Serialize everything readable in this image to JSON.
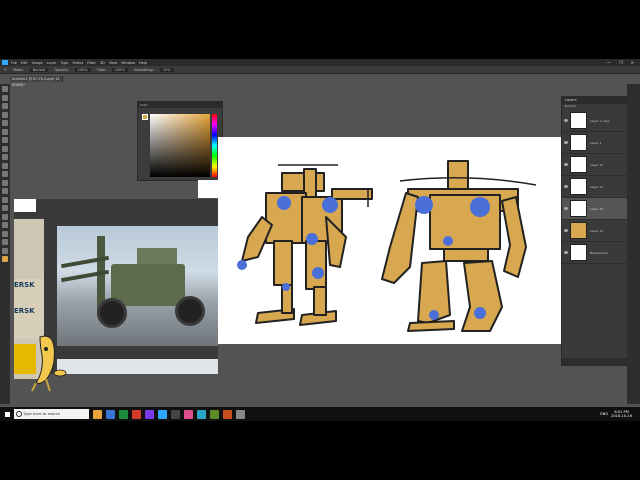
{
  "app": {
    "menu": [
      "File",
      "Edit",
      "Image",
      "Layer",
      "Type",
      "Select",
      "Filter",
      "3D",
      "View",
      "Window",
      "Help"
    ],
    "options": [
      "Mode:",
      "Normal",
      "Opacity:",
      "100%",
      "Flow:",
      "100%",
      "Smoothing:",
      "10%"
    ],
    "doc_tab": "Untitled-1 @ 67.2% (Layer 10, RGB/8)*",
    "window_controls": [
      "—",
      "❐",
      "✕"
    ]
  },
  "color_picker": {
    "title": "Color",
    "fg_color": "#d9a64e"
  },
  "layers": {
    "title": "Layers",
    "blend_mode": "Normal",
    "items": [
      {
        "name": "Layer 1 copy",
        "active": false
      },
      {
        "name": "Layer 1",
        "active": false
      },
      {
        "name": "Layer 12",
        "active": false
      },
      {
        "name": "Layer 11",
        "active": false
      },
      {
        "name": "Layer 10",
        "active": true
      },
      {
        "name": "Layer 13",
        "active": false
      },
      {
        "name": "Background",
        "active": false
      }
    ]
  },
  "reference": {
    "container_text_1": "ERSK",
    "container_text_2": "ERSK"
  },
  "taskbar": {
    "search_placeholder": "Type here to search",
    "time": "6:01 PM",
    "date": "2018-10-16",
    "lang": "ENG",
    "app_colors": [
      "#e8a33c",
      "#3a78d8",
      "#1e8a3c",
      "#d23a2a",
      "#7c3aed",
      "#31a8ff",
      "#444444",
      "#e04e8c",
      "#2aa4c9",
      "#5a8a2a",
      "#c84d1e",
      "#888888"
    ]
  },
  "colors": {
    "robot_fill": "#d8a850",
    "robot_blue": "#4a6fd8",
    "ink": "#222222"
  }
}
